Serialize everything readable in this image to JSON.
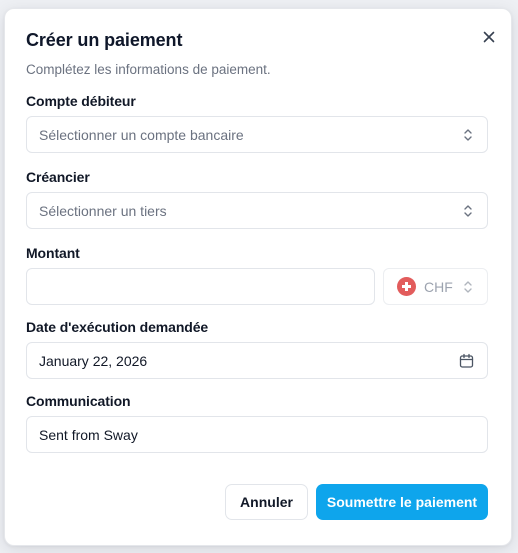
{
  "dialog": {
    "title": "Créer un paiement",
    "subtitle": "Complétez les informations de paiement."
  },
  "debtor_account": {
    "label": "Compte débiteur",
    "placeholder": "Sélectionner un compte bancaire"
  },
  "creditor": {
    "label": "Créancier",
    "placeholder": "Sélectionner un tiers"
  },
  "amount": {
    "label": "Montant",
    "value": "",
    "currency": "CHF"
  },
  "execution_date": {
    "label": "Date d'exécution demandée",
    "value": "January 22, 2026"
  },
  "communication": {
    "label": "Communication",
    "value": "Sent from Sway"
  },
  "actions": {
    "cancel": "Annuler",
    "submit": "Soumettre le paiement"
  },
  "colors": {
    "primary": "#0ea5ec",
    "flag": "#e25c5c"
  }
}
